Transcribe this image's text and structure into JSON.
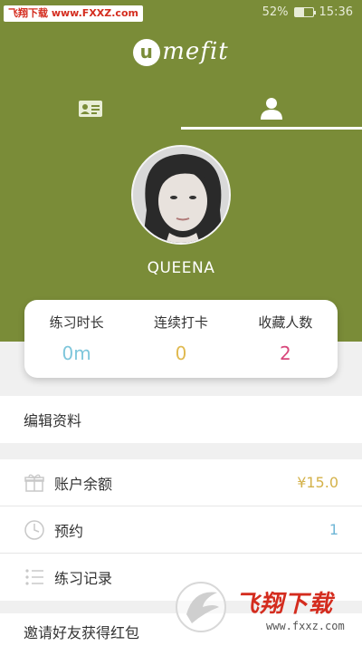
{
  "statusbar": {
    "watermark_site_cn": "飞翔下载",
    "watermark_site_url": "www.FXXZ.com",
    "battery_percent": "52%",
    "battery_level": 0.52,
    "time": "15:36"
  },
  "header": {
    "logo_mark": "u",
    "logo_text": "mefit",
    "tabs": [
      {
        "icon": "contact-card-icon",
        "active": false
      },
      {
        "icon": "person-icon",
        "active": true
      }
    ]
  },
  "profile": {
    "username": "QUEENA"
  },
  "stats": [
    {
      "label": "练习时长",
      "value": "0m",
      "color": "#7ec6db"
    },
    {
      "label": "连续打卡",
      "value": "0",
      "color": "#e0b94f"
    },
    {
      "label": "收藏人数",
      "value": "2",
      "color": "#d8477b"
    }
  ],
  "menu": {
    "edit_profile": "编辑资料",
    "items": [
      {
        "icon": "gift-icon",
        "label": "账户余额",
        "value": "¥15.0",
        "value_color": "#d4b24a"
      },
      {
        "icon": "clock-icon",
        "label": "预约",
        "value": "1",
        "value_color": "#6fb6d6"
      },
      {
        "icon": "list-icon",
        "label": "练习记录",
        "value": ""
      }
    ],
    "invite": "邀请好友获得红包"
  },
  "watermark": {
    "text": "飞翔下载",
    "url": "www.fxxz.com"
  },
  "colors": {
    "brand": "#7a8c38"
  }
}
